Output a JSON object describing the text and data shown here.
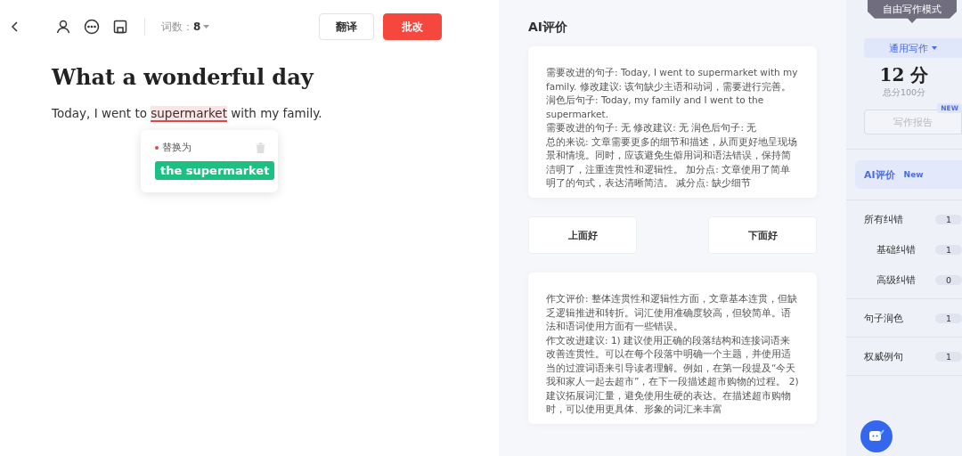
{
  "toolbar": {
    "word_count_label": "词数：",
    "word_count": "8",
    "buttons": [
      {
        "label": "翻译",
        "kind": "secondary"
      },
      {
        "label": "批改",
        "kind": "primary"
      }
    ]
  },
  "essay": {
    "title": "What a wonderful day",
    "before": "Today, I went to ",
    "flagged": "supermarket",
    "after": " with my family."
  },
  "suggestion": {
    "label": "替换为",
    "replacement": "the supermarket"
  },
  "review": {
    "heading": "AI评价",
    "card_1": [
      "需要改进的句子: Today, I went to supermarket with my family. 修改建议: 该句缺少主语和动词，需要进行完善。润色后句子: Today, my family and I went to the supermarket.",
      "需要改进的句子: 无 修改建议: 无 润色后句子: 无",
      "总的来说: 文章需要更多的细节和描述，从而更好地呈现场景和情境。同时，应该避免生僻用词和语法错误，保持简洁明了，注重连贯性和逻辑性。 加分点: 文章使用了简单明了的句式，表达清晰简洁。 减分点: 缺少细节"
    ],
    "votes": [
      "上面好",
      "下面好"
    ],
    "card_2": [
      "作文评价: 整体连贯性和逻辑性方面，文章基本连贯，但缺乏逻辑推进和转折。词汇使用准确度较高，但较简单。语法和语词使用方面有一些错误。",
      "作文改进建议: 1) 建议使用正确的段落结构和连接词语来改善连贯性。可以在每个段落中明确一个主题，并使用适当的过渡词语来引导读者理解。例如，在第一段提及“今天我和家人一起去超市”，在下一段描述超市购物的过程。 2) 建议拓展词汇量，避免使用生硬的表达。在描述超市购物时，可以使用更具体、形象的词汇来丰富"
    ]
  },
  "sidebar": {
    "mode_tooltip": "自由写作模式",
    "genre": "通用写作",
    "score": "12 分",
    "total": "总分100分",
    "report": {
      "label": "写作报告",
      "badge": "NEW"
    },
    "items": [
      {
        "label": "AI评价",
        "badge": "New",
        "selected": true
      },
      {
        "label": "所有纠错",
        "count": "1",
        "selected": false,
        "children": [
          {
            "label": "基础纠错",
            "count": "1",
            "selected": false
          },
          {
            "label": "高级纠错",
            "count": "0",
            "selected": false
          }
        ]
      },
      {
        "label": "句子润色",
        "count": "1",
        "selected": false
      },
      {
        "label": "权威例句",
        "count": "1",
        "selected": false
      }
    ]
  }
}
